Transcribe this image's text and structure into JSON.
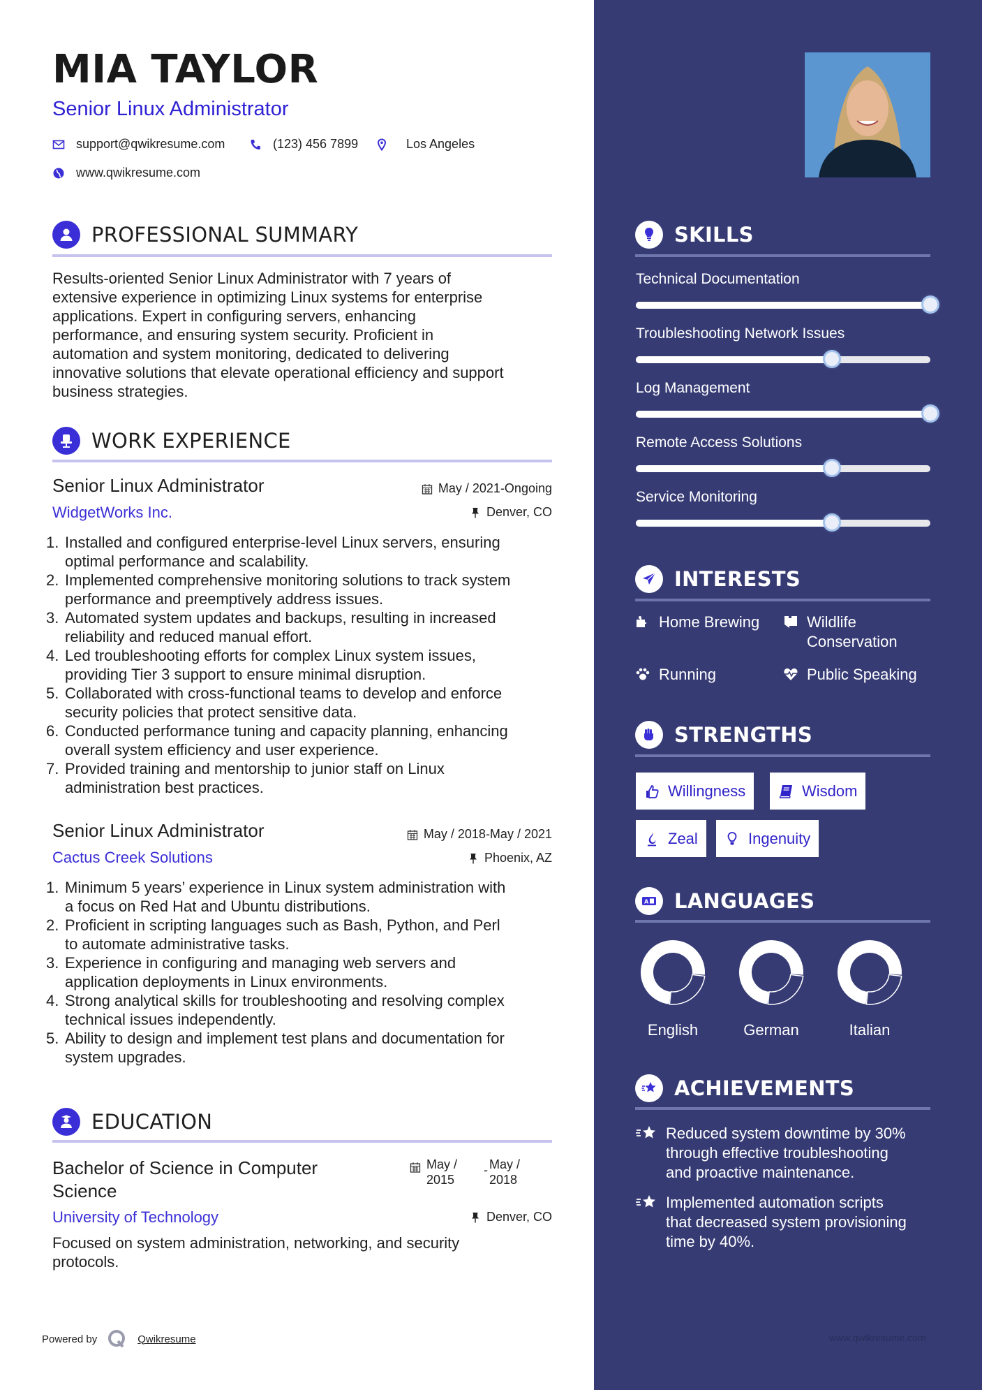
{
  "header": {
    "name": "MIA TAYLOR",
    "title": "Senior Linux Administrator",
    "contacts": {
      "email": "support@qwikresume.com",
      "phone": "(123) 456 7899",
      "location": "Los Angeles",
      "website": "www.qwikresume.com"
    }
  },
  "summary": {
    "heading": "PROFESSIONAL SUMMARY",
    "lines": [
      "Results-oriented Senior Linux Administrator with 7 years of",
      "extensive experience in optimizing Linux systems for enterprise",
      "applications. Expert in configuring servers, enhancing",
      "performance, and ensuring system security. Proficient in",
      "automation and system monitoring, dedicated to delivering",
      "innovative solutions that elevate operational efficiency and support",
      "business strategies."
    ]
  },
  "experience": {
    "heading": "WORK EXPERIENCE",
    "jobs": [
      {
        "title": "Senior Linux Administrator",
        "company": "WidgetWorks Inc.",
        "dates": "May / 2021-Ongoing",
        "location": "Denver, CO",
        "duties": [
          {
            "num": "1.",
            "lines": [
              "Installed and configured enterprise-level Linux servers, ensuring",
              "optimal performance and scalability."
            ]
          },
          {
            "num": "2.",
            "lines": [
              "Implemented comprehensive monitoring solutions to track system",
              "performance and preemptively address issues."
            ]
          },
          {
            "num": "3.",
            "lines": [
              "Automated system updates and backups, resulting in increased",
              "reliability and reduced manual effort."
            ]
          },
          {
            "num": "4.",
            "lines": [
              "Led troubleshooting efforts for complex Linux system issues,",
              "providing Tier 3 support to ensure minimal disruption."
            ]
          },
          {
            "num": "5.",
            "lines": [
              "Collaborated with cross-functional teams to develop and enforce",
              "security policies that protect sensitive data."
            ]
          },
          {
            "num": "6.",
            "lines": [
              "Conducted performance tuning and capacity planning, enhancing",
              "overall system efficiency and user experience."
            ]
          },
          {
            "num": "7.",
            "lines": [
              "Provided training and mentorship to junior staff on Linux",
              "administration best practices."
            ]
          }
        ]
      },
      {
        "title": "Senior Linux Administrator",
        "company": "Cactus Creek Solutions",
        "dates": "May / 2018-May / 2021",
        "location": "Phoenix, AZ",
        "duties": [
          {
            "num": "1.",
            "lines": [
              "Minimum 5 years’ experience in Linux system administration with",
              "a focus on Red Hat and Ubuntu distributions."
            ]
          },
          {
            "num": "2.",
            "lines": [
              "Proficient in scripting languages such as Bash, Python, and Perl",
              "to automate administrative tasks."
            ]
          },
          {
            "num": "3.",
            "lines": [
              "Experience in configuring and managing web servers and",
              "application deployments in Linux environments."
            ]
          },
          {
            "num": "4.",
            "lines": [
              "Strong analytical skills for troubleshooting and resolving complex",
              "technical issues independently."
            ]
          },
          {
            "num": "5.",
            "lines": [
              "Ability to design and implement test plans and documentation for",
              "system upgrades."
            ]
          }
        ]
      }
    ]
  },
  "education": {
    "heading": "EDUCATION",
    "degree_lines": [
      "Bachelor of Science in Computer",
      "Science"
    ],
    "school": "University of Technology",
    "start": [
      "May /",
      "2015"
    ],
    "separator": "-",
    "end": [
      "May /",
      "2018"
    ],
    "location": "Denver, CO",
    "description_lines": [
      "Focused on system administration, networking, and security",
      "protocols."
    ]
  },
  "footer": {
    "powered_by": "Powered by",
    "brand": "Qwikresume",
    "website": "www.qwikresume.com"
  },
  "sidebar": {
    "skills": {
      "heading": "SKILLS",
      "items": [
        {
          "label": "Technical Documentation",
          "level": 1.0
        },
        {
          "label": "Troubleshooting Network Issues",
          "level": 0.667
        },
        {
          "label": "Log Management",
          "level": 1.0
        },
        {
          "label": "Remote Access Solutions",
          "level": 0.667
        },
        {
          "label": "Service Monitoring",
          "level": 0.667
        }
      ]
    },
    "interests": {
      "heading": "INTERESTS",
      "items": [
        {
          "label_lines": [
            "Home Brewing"
          ],
          "icon": "puzzle-icon"
        },
        {
          "label_lines": [
            "Wildlife",
            "Conservation"
          ],
          "icon": "map-icon"
        },
        {
          "label_lines": [
            "Running"
          ],
          "icon": "paw-icon"
        },
        {
          "label_lines": [
            "Public Speaking"
          ],
          "icon": "heartbeat-icon"
        }
      ]
    },
    "strengths": {
      "heading": "STRENGTHS",
      "items": [
        {
          "label": "Willingness",
          "icon": "thumbs-up-icon"
        },
        {
          "label": "Wisdom",
          "icon": "book-icon"
        },
        {
          "label": "Zeal",
          "icon": "fire-icon"
        },
        {
          "label": "Ingenuity",
          "icon": "lightbulb-icon"
        }
      ]
    },
    "languages": {
      "heading": "LANGUAGES",
      "items": [
        {
          "label": "English",
          "level": 0.75
        },
        {
          "label": "German",
          "level": 0.75
        },
        {
          "label": "Italian",
          "level": 0.75
        }
      ]
    },
    "achievements": {
      "heading": "ACHIEVEMENTS",
      "items": [
        {
          "lines": [
            "Reduced system downtime by 30%",
            "through effective troubleshooting",
            "and proactive maintenance."
          ]
        },
        {
          "lines": [
            "Implemented automation scripts",
            "that decreased system provisioning",
            "time by 40%."
          ]
        }
      ]
    }
  },
  "colors": {
    "accent": "#3a2fd6",
    "sidebar_bg": "#363b74",
    "rule_main": "#c6c3ef",
    "rule_sidebar": "#6f76ad",
    "text": "#1f1f1f",
    "white": "#ffffff"
  }
}
